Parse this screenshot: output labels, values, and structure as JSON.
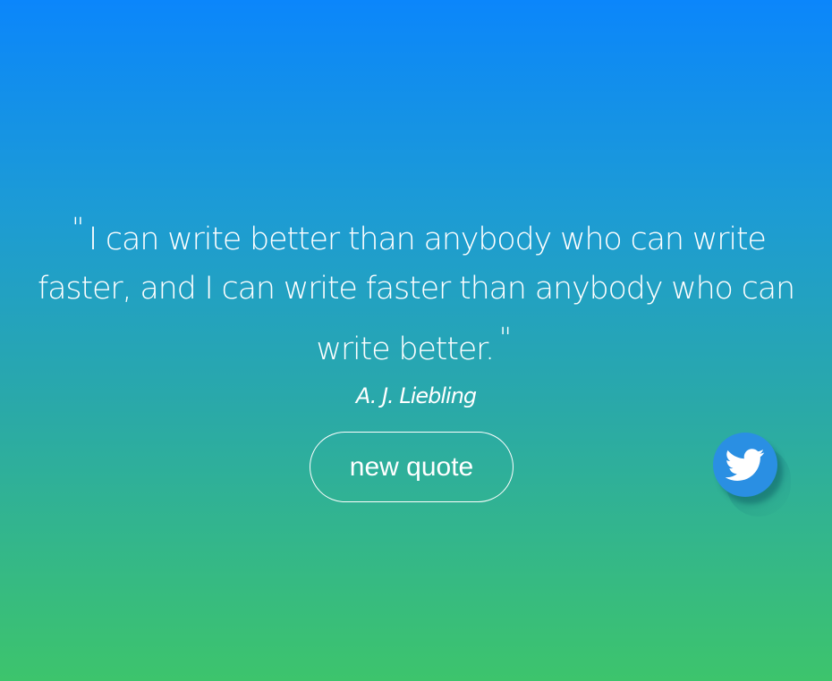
{
  "quote": {
    "open_mark": "\"",
    "text": "I can write better than anybody who can write faster, and I can write faster than anybody who can write better.",
    "close_mark": "\"",
    "author": "A. J. Liebling"
  },
  "actions": {
    "new_quote_label": "new quote",
    "tweet_icon": "twitter-bird-icon"
  },
  "colors": {
    "gradient_top": "#0b86fb",
    "gradient_bottom": "#3dc46c",
    "twitter_blue": "#2a8fe3",
    "text": "#ffffff"
  }
}
